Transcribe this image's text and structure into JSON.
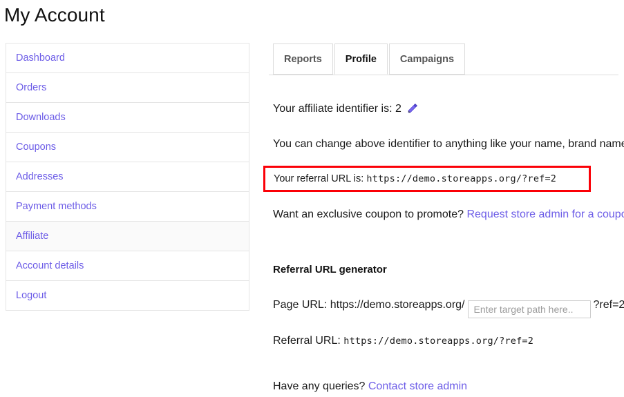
{
  "page": {
    "title": "My Account"
  },
  "sidebar": {
    "items": [
      {
        "label": "Dashboard",
        "active": false
      },
      {
        "label": "Orders",
        "active": false
      },
      {
        "label": "Downloads",
        "active": false
      },
      {
        "label": "Coupons",
        "active": false
      },
      {
        "label": "Addresses",
        "active": false
      },
      {
        "label": "Payment methods",
        "active": false
      },
      {
        "label": "Affiliate",
        "active": true
      },
      {
        "label": "Account details",
        "active": false
      },
      {
        "label": "Logout",
        "active": false
      }
    ]
  },
  "tabs": [
    {
      "label": "Reports",
      "active": false
    },
    {
      "label": "Profile",
      "active": true
    },
    {
      "label": "Campaigns",
      "active": false
    }
  ],
  "profile": {
    "identifier_label": "Your affiliate identifier is:",
    "identifier_value": "2",
    "edit_icon": "pencil-icon",
    "change_note": "You can change above identifier to anything like your name, brand name.",
    "referral_label": "Your referral URL is:",
    "referral_url": "https://demo.storeapps.org/?ref=2",
    "coupon_question": "Want an exclusive coupon to promote?",
    "coupon_link": "Request store admin for a coupon",
    "generator_heading": "Referral URL generator",
    "page_url_label": "Page URL:",
    "page_url_base": "https://demo.storeapps.org/",
    "page_url_placeholder": "Enter target path here..",
    "page_url_suffix": "?ref=2",
    "generated_label": "Referral URL:",
    "generated_url": "https://demo.storeapps.org/?ref=2",
    "queries_question": "Have any queries?",
    "queries_link": "Contact store admin"
  },
  "colors": {
    "link": "#6c5ce7",
    "highlight_border": "#fb0007",
    "active_row_bg": "#fafafa"
  }
}
